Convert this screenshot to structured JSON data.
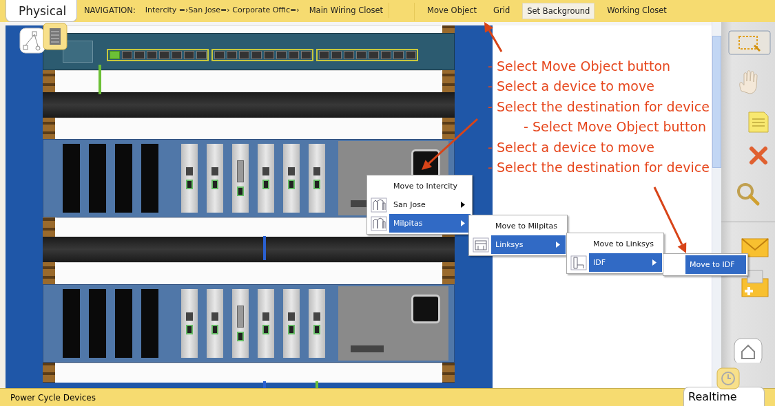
{
  "mode_tab": {
    "label": "Physical"
  },
  "navigation": {
    "label": "NAVIGATION:",
    "path": "Intercity =›San Jose=› Corporate Offic=›",
    "current": "Main Wiring Closet"
  },
  "toolbar_buttons": [
    {
      "label": "Move Object",
      "pressed": false
    },
    {
      "label": "Grid",
      "pressed": false
    },
    {
      "label": "Set Background",
      "pressed": true
    },
    {
      "label": "Working Closet",
      "pressed": false
    }
  ],
  "switch": {
    "ports": [
      {
        "connected": true
      },
      {
        "connected": false
      },
      {
        "connected": false
      },
      {
        "connected": false
      },
      {
        "connected": false
      },
      {
        "connected": false
      },
      {
        "connected": false
      },
      {
        "connected": false
      },
      {
        "connected": false
      },
      {
        "connected": false
      },
      {
        "connected": false
      },
      {
        "connected": false
      },
      {
        "connected": false
      },
      {
        "connected": false
      },
      {
        "connected": false
      },
      {
        "connected": false
      },
      {
        "connected": false
      },
      {
        "connected": false
      },
      {
        "connected": false
      },
      {
        "connected": false
      },
      {
        "connected": false
      },
      {
        "connected": false
      },
      {
        "connected": false
      },
      {
        "connected": false
      }
    ]
  },
  "annotations": [
    {
      "text": "- Select Move Object button",
      "indented": false
    },
    {
      "text": "- Select a device to move",
      "indented": false
    },
    {
      "text": "- Select the destination for device",
      "indented": false
    },
    {
      "text": "- Select Move Object button",
      "indented": true
    },
    {
      "text": "- Select a device to move",
      "indented": false
    },
    {
      "text": "- Select the destination for device",
      "indented": false
    }
  ],
  "menus": [
    {
      "items": [
        {
          "label": "Move to Intercity",
          "kind": "action",
          "selected": false
        },
        {
          "label": "San Jose",
          "kind": "submenu",
          "selected": false
        },
        {
          "label": "Milpitas",
          "kind": "submenu",
          "selected": true
        }
      ]
    },
    {
      "items": [
        {
          "label": "Move to Milpitas",
          "kind": "action",
          "selected": false
        },
        {
          "label": "Linksys",
          "kind": "submenu",
          "selected": true
        }
      ]
    },
    {
      "items": [
        {
          "label": "Move to Linksys",
          "kind": "action",
          "selected": false
        },
        {
          "label": "IDF",
          "kind": "submenu",
          "selected": true
        }
      ]
    },
    {
      "items": [
        {
          "label": "Move to IDF",
          "kind": "action",
          "selected": true
        }
      ]
    }
  ],
  "status_bar": {
    "text": "Power Cycle Devices",
    "mode": "Realtime"
  }
}
